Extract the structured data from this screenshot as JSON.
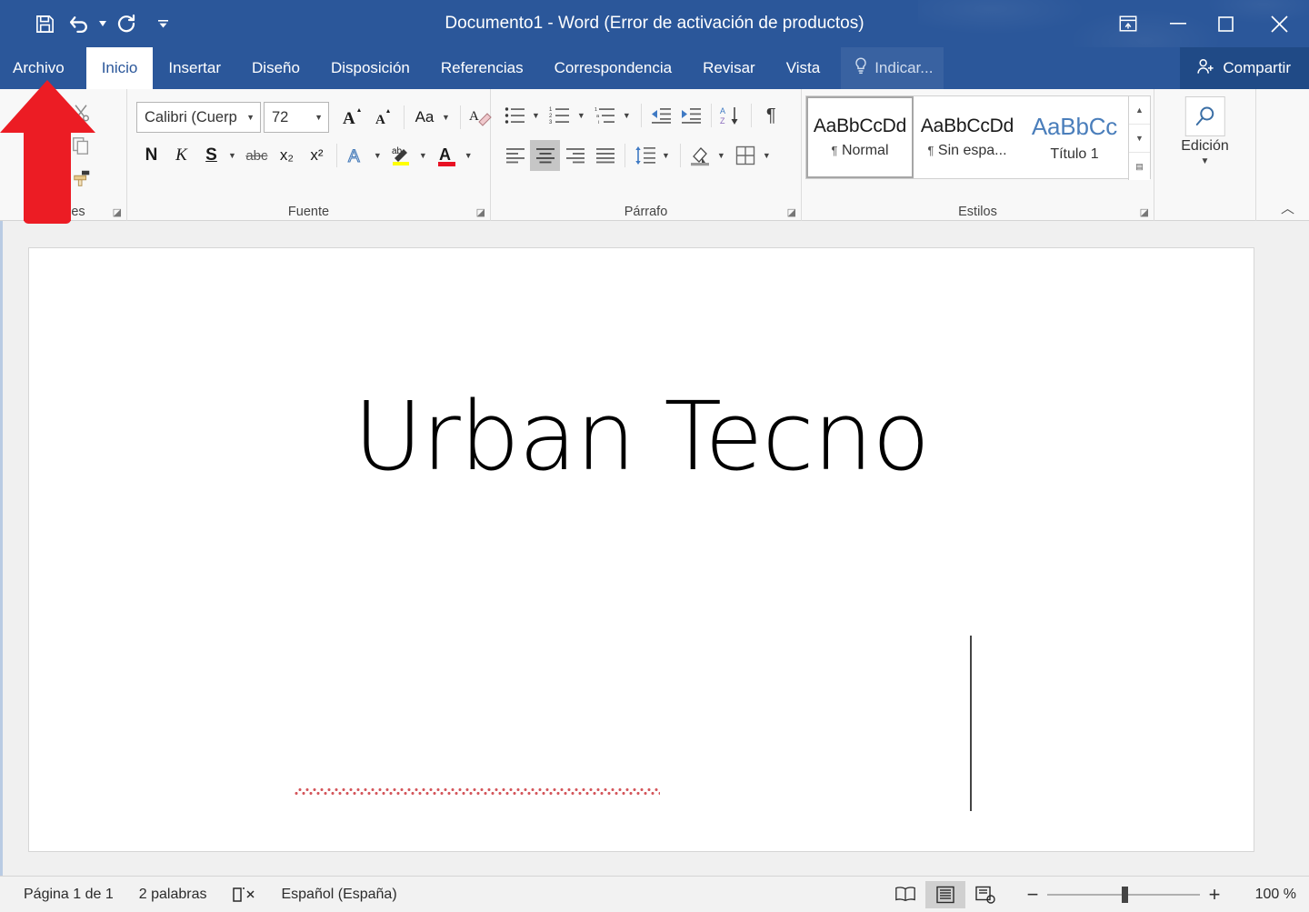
{
  "titlebar": {
    "title": "Documento1 - Word (Error de activación de productos)",
    "quick_access": [
      {
        "name": "save-icon",
        "label": "Guardar"
      },
      {
        "name": "undo-icon",
        "label": "Deshacer"
      },
      {
        "name": "redo-icon",
        "label": "Rehacer"
      },
      {
        "name": "customize-qat-icon",
        "label": "Personalizar barra de herramientas de acceso rápido"
      }
    ],
    "window_buttons": [
      {
        "name": "ribbon-display-options-icon",
        "label": "Opciones de presentación de la cinta de opciones"
      },
      {
        "name": "minimize-icon",
        "label": "Minimizar"
      },
      {
        "name": "maximize-icon",
        "label": "Maximizar"
      },
      {
        "name": "close-icon",
        "label": "Cerrar"
      }
    ]
  },
  "tabs": {
    "items": [
      {
        "label": "Archivo",
        "active": false
      },
      {
        "label": "Inicio",
        "active": true
      },
      {
        "label": "Insertar",
        "active": false
      },
      {
        "label": "Diseño",
        "active": false
      },
      {
        "label": "Disposición",
        "active": false
      },
      {
        "label": "Referencias",
        "active": false
      },
      {
        "label": "Correspondencia",
        "active": false
      },
      {
        "label": "Revisar",
        "active": false
      },
      {
        "label": "Vista",
        "active": false
      }
    ],
    "tell_me": "Indicar...",
    "share": "Compartir"
  },
  "ribbon": {
    "groups": {
      "clipboard": {
        "label": "Portapapeles",
        "visible_label": "Po          eles"
      },
      "font": {
        "label": "Fuente"
      },
      "paragraph": {
        "label": "Párrafo"
      },
      "styles": {
        "label": "Estilos"
      },
      "editing": {
        "label": "Edición"
      }
    },
    "font": {
      "font_name": "Calibri (Cuerp",
      "font_name_full": "Calibri (Cuerpo)",
      "font_size": "72",
      "buttons": {
        "grow": "A",
        "shrink": "A",
        "change_case": "Aa",
        "clear_formatting": "Borrar todo el formato",
        "bold": "N",
        "italic": "K",
        "underline": "S",
        "strikethrough": "abc",
        "subscript": "x₂",
        "superscript": "x²",
        "text_effects": "A",
        "highlight": "ab",
        "font_color": "A"
      }
    },
    "paragraph": {
      "active_alignment": "center"
    },
    "styles": {
      "gallery": [
        {
          "preview": "AaBbCcDd",
          "name": "Normal",
          "selected": true,
          "pilcrow": true
        },
        {
          "preview": "AaBbCcDd",
          "name": "Sin espa...",
          "selected": false,
          "pilcrow": true
        },
        {
          "preview": "AaBbCc",
          "name": "Título 1",
          "selected": false,
          "pilcrow": false
        }
      ]
    },
    "editing": {
      "label": "Edición",
      "icon": "search-icon"
    }
  },
  "document": {
    "text": "Urban Tecno",
    "misspelled_word": "Urban",
    "font": "Calibri Light",
    "font_size": 72,
    "alignment": "center"
  },
  "statusbar": {
    "page": "Página 1 de 1",
    "words": "2 palabras",
    "proofing_icon": "spelling-check-icon",
    "language": "Español (España)",
    "views": [
      {
        "name": "read-mode-icon",
        "label": "Modo de lectura",
        "active": false
      },
      {
        "name": "print-layout-icon",
        "label": "Diseño de impresión",
        "active": true
      },
      {
        "name": "web-layout-icon",
        "label": "Diseño web",
        "active": false
      }
    ],
    "zoom_out": "−",
    "zoom_in": "+",
    "zoom_level": "100 %"
  },
  "annotation": {
    "arrow": {
      "name": "red-arrow-pointing-to-archivo-tab",
      "color": "#ec1c24",
      "target": "Archivo"
    }
  },
  "colors": {
    "titlebar_blue": "#2b579a",
    "share_blue": "#204a86",
    "ribbon_bg": "#f8f8f8",
    "doc_bg": "#f0f0f0",
    "arrow_red": "#ec1c24",
    "spell_red": "#d4565b"
  }
}
